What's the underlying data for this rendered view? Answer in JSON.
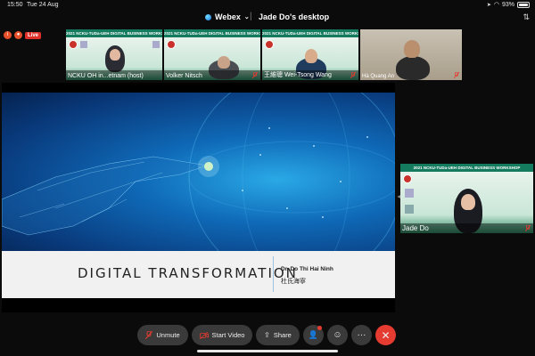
{
  "status_bar": {
    "time": "15:50",
    "date": "Tue 24 Aug",
    "battery": "93%",
    "battery_level": 0.93
  },
  "topbar": {
    "app_name": "Webex",
    "window_title": "Jade Do's desktop"
  },
  "recording": {
    "live_label": "Live"
  },
  "banner_text": "2021 NCKU-TUDa-UEH DIGITAL BUSINESS WORKSHOP",
  "participants": [
    {
      "name": "NCKU OH in...etnam (host)"
    },
    {
      "name": "Volker Nitsch"
    },
    {
      "name": "王維聰  Wei-Tsong Wang"
    },
    {
      "name": "Hà Quang An"
    }
  ],
  "active_speaker": {
    "name": "Jade Do"
  },
  "slide": {
    "title": "DIGITAL TRANSFORMATION",
    "author": "Dr. Do Thi Hai Ninh",
    "author_cn": "杜氏海寧"
  },
  "controls": {
    "unmute": "Unmute",
    "start_video": "Start Video",
    "share": "Share"
  },
  "colors": {
    "accent": "#157b5f",
    "end_call": "#e53b30",
    "live": "#e0302a"
  }
}
